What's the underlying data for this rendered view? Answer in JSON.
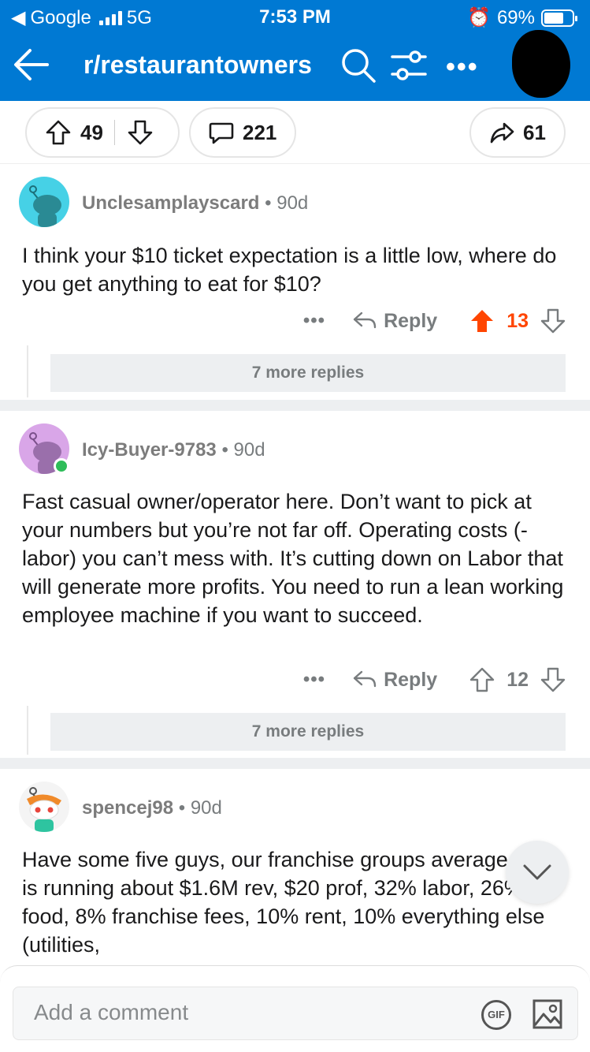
{
  "status_bar": {
    "carrier": "Google",
    "network": "5G",
    "time": "7:53 PM",
    "battery": "69%"
  },
  "header": {
    "title": "r/restaurantowners",
    "bg_color": "#0079d3"
  },
  "post_actions": {
    "votes": "49",
    "comments": "221",
    "shares": "61"
  },
  "comments": [
    {
      "username": "Unclesamplayscard",
      "age": "90d",
      "text": "I think your $10 ticket expectation is a little low, where do you get anything to eat for $10?",
      "reply_label": "Reply",
      "score": "13",
      "upvoted": true,
      "more_replies": "7 more replies",
      "avatar_color": "#46d1e6"
    },
    {
      "username": "Icy-Buyer-9783",
      "age": "90d",
      "text": "Fast casual owner/operator here.  Don’t want to pick at your numbers but you’re not far off.  Operating costs (-labor) you can’t mess with.  It’s cutting down on Labor that will generate more profits.  You need to run a lean working employee machine if you want to succeed.",
      "reply_label": "Reply",
      "score": "12",
      "upvoted": false,
      "more_replies": "7 more replies",
      "avatar_color": "#d9a6e8"
    },
    {
      "username": "spencej98",
      "age": "90d",
      "text": "Have some five guys, our franchise groups average store is running about $1.6M rev, $20 prof, 32% labor, 26% food, 8% franchise fees, 10% rent, 10% everything else (utilities,",
      "avatar_color": "#f4f4f4"
    }
  ],
  "composer": {
    "placeholder": "Add a comment",
    "gif_label": "GIF"
  },
  "colors": {
    "upvote_active": "#ff4500",
    "muted": "#787c7e"
  }
}
